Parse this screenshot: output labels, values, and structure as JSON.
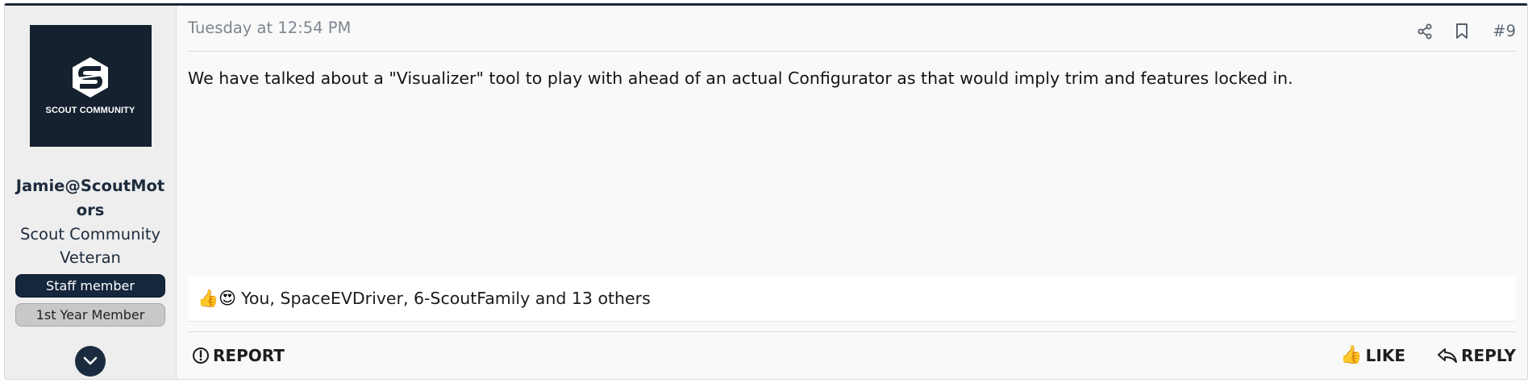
{
  "user": {
    "avatar_text": "SCOUT COMMUNITY",
    "username": "Jamie@ScoutMotors",
    "title": "Scout Community Veteran",
    "banners": [
      "Staff member",
      "1st Year Member"
    ]
  },
  "post": {
    "date": "Tuesday at 12:54 PM",
    "number": "#9",
    "body": "We have talked about a \"Visualizer\" tool to play with ahead of an actual Configurator as that would imply trim and features locked in.",
    "reactions": {
      "emojis": [
        "👍",
        "😍"
      ],
      "text": "You, SpaceEVDriver, 6-ScoutFamily and 13 others"
    }
  },
  "actions": {
    "report": "REPORT",
    "like": "LIKE",
    "reply": "REPLY"
  },
  "colors": {
    "brand_navy": "#15212f",
    "staff_banner": "#15273d",
    "member_banner": "#c8c8c8",
    "date_text": "#7d8691"
  },
  "icons": {
    "share": "share-icon",
    "bookmark": "bookmark-icon",
    "report": "alert-circle-icon",
    "like": "thumbs-up-icon",
    "reply": "reply-arrow-icon",
    "expand": "chevron-down-icon"
  }
}
